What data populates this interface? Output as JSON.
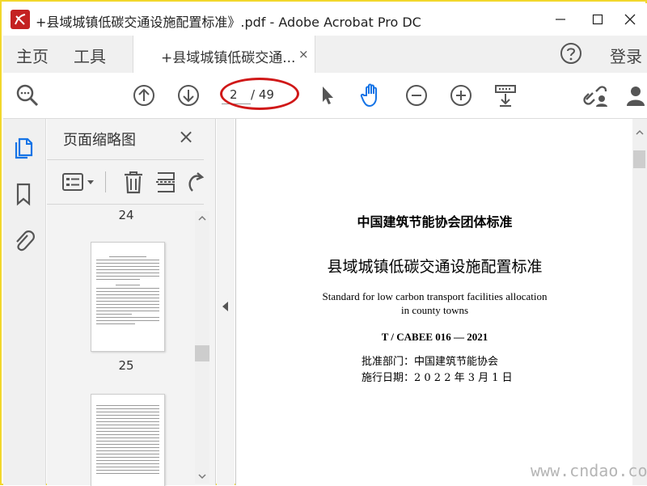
{
  "window": {
    "title": "+县域城镇低碳交通设施配置标准》.pdf - Adobe Acrobat Pro DC"
  },
  "nav": {
    "home": "主页",
    "tools": "工具",
    "doc_tab": "+县域城镇低碳交通...",
    "close_tab": "×",
    "login": "登录"
  },
  "toolbar": {
    "page_current": "2",
    "page_total": "/ 49"
  },
  "thumbnail_panel": {
    "title": "页面缩略图",
    "close": "×",
    "page_labels": [
      "24",
      "25"
    ]
  },
  "document": {
    "org_title": "中国建筑节能协会团体标准",
    "main_title": "县域城镇低碳交通设施配置标准",
    "en_title_1": "Standard for low carbon transport facilities allocation",
    "en_title_2": "in county towns",
    "code": "T / CABEE 016 — 2021",
    "approver": "批准部门：中国建筑节能协会",
    "effective": "施行日期：2 0 2 2 年 3 月 1 日"
  },
  "watermark": "www.cndao.com",
  "colors": {
    "frame": "#f2d72c",
    "accent_blue": "#1473e6",
    "highlight_red": "#d01818"
  }
}
